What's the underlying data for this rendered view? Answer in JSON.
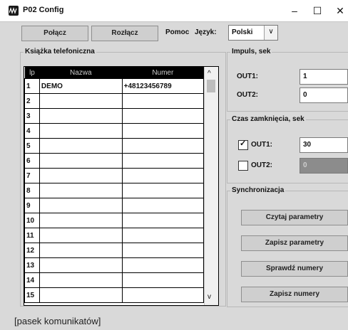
{
  "window": {
    "title": "P02 Config",
    "icon": "app-logo-icon",
    "min_glyph": "–",
    "max_glyph": "☐",
    "close_glyph": "✕"
  },
  "toolbar": {
    "connect_label": "Połącz",
    "disconnect_label": "Rozłącz",
    "help_label": "Pomoc",
    "language_label": "Język:",
    "language_value": "Polski",
    "language_arrow": "∨"
  },
  "phonebook": {
    "title": "Książka telefoniczna",
    "headers": [
      "lp",
      "Nazwa",
      "Numer"
    ],
    "rows": [
      {
        "lp": "1",
        "name": "DEMO",
        "number": "+48123456789"
      },
      {
        "lp": "2",
        "name": "",
        "number": ""
      },
      {
        "lp": "3",
        "name": "",
        "number": ""
      },
      {
        "lp": "4",
        "name": "",
        "number": ""
      },
      {
        "lp": "5",
        "name": "",
        "number": ""
      },
      {
        "lp": "6",
        "name": "",
        "number": ""
      },
      {
        "lp": "7",
        "name": "",
        "number": ""
      },
      {
        "lp": "8",
        "name": "",
        "number": ""
      },
      {
        "lp": "9",
        "name": "",
        "number": ""
      },
      {
        "lp": "10",
        "name": "",
        "number": ""
      },
      {
        "lp": "11",
        "name": "",
        "number": ""
      },
      {
        "lp": "12",
        "name": "",
        "number": ""
      },
      {
        "lp": "13",
        "name": "",
        "number": ""
      },
      {
        "lp": "14",
        "name": "",
        "number": ""
      },
      {
        "lp": "15",
        "name": "",
        "number": ""
      }
    ],
    "scroll_up": "^",
    "scroll_down": "v"
  },
  "impuls": {
    "title": "Impuls, sek",
    "out1_label": "OUT1:",
    "out1_value": "1",
    "out2_label": "OUT2:",
    "out2_value": "0"
  },
  "czas": {
    "title": "Czas zamknięcia, sek",
    "out1_label": "OUT1:",
    "out1_value": "30",
    "out1_checked": true,
    "out2_label": "OUT2:",
    "out2_value": "0",
    "out2_checked": false,
    "check_glyph": "✓"
  },
  "sync": {
    "title": "Synchronizacja",
    "read_params": "Czytaj parametry",
    "write_params": "Zapisz parametry",
    "check_numbers": "Sprawdź numery",
    "write_numbers": "Zapisz numery"
  },
  "status": {
    "text": "[pasek komunikatów]"
  }
}
